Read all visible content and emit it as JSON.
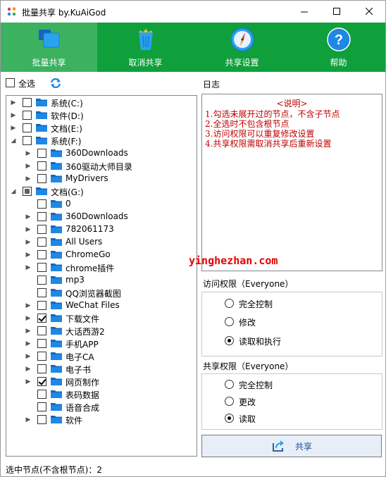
{
  "window": {
    "title": "批量共享 by.KuAiGod",
    "controls": [
      "minimize",
      "maximize",
      "close"
    ]
  },
  "toolbar": {
    "items": [
      {
        "label": "批量共享",
        "icon": "windows-icon",
        "active": true
      },
      {
        "label": "取消共享",
        "icon": "recycle-bin-icon",
        "active": false
      },
      {
        "label": "共享设置",
        "icon": "compass-icon",
        "active": false
      },
      {
        "label": "帮助",
        "icon": "help-icon",
        "active": false
      }
    ]
  },
  "left": {
    "select_all_label": "全选",
    "refresh_icon": "refresh-icon",
    "tree": [
      {
        "label": "系统(C:)",
        "level": 0,
        "arrow": "collapsed",
        "check": "none"
      },
      {
        "label": "软件(D:)",
        "level": 0,
        "arrow": "collapsed",
        "check": "none"
      },
      {
        "label": "文档(E:)",
        "level": 0,
        "arrow": "collapsed",
        "check": "none"
      },
      {
        "label": "系统(F:)",
        "level": 0,
        "arrow": "expanded",
        "check": "none"
      },
      {
        "label": "360Downloads",
        "level": 1,
        "arrow": "collapsed",
        "check": "none"
      },
      {
        "label": "360驱动大师目录",
        "level": 1,
        "arrow": "collapsed",
        "check": "none"
      },
      {
        "label": "MyDrivers",
        "level": 1,
        "arrow": "collapsed",
        "check": "none"
      },
      {
        "label": "文档(G:)",
        "level": 0,
        "arrow": "expanded",
        "check": "partial"
      },
      {
        "label": "0",
        "level": 1,
        "arrow": "none",
        "check": "none"
      },
      {
        "label": "360Downloads",
        "level": 1,
        "arrow": "collapsed",
        "check": "none"
      },
      {
        "label": "782061173",
        "level": 1,
        "arrow": "collapsed",
        "check": "none"
      },
      {
        "label": "All Users",
        "level": 1,
        "arrow": "collapsed",
        "check": "none"
      },
      {
        "label": "ChromeGo",
        "level": 1,
        "arrow": "collapsed",
        "check": "none"
      },
      {
        "label": "chrome插件",
        "level": 1,
        "arrow": "collapsed",
        "check": "none"
      },
      {
        "label": "mp3",
        "level": 1,
        "arrow": "none",
        "check": "none"
      },
      {
        "label": "QQ浏览器截图",
        "level": 1,
        "arrow": "none",
        "check": "none"
      },
      {
        "label": "WeChat Files",
        "level": 1,
        "arrow": "collapsed",
        "check": "none"
      },
      {
        "label": "下载文件",
        "level": 1,
        "arrow": "collapsed",
        "check": "checked"
      },
      {
        "label": "大话西游2",
        "level": 1,
        "arrow": "collapsed",
        "check": "none"
      },
      {
        "label": "手机APP",
        "level": 1,
        "arrow": "collapsed",
        "check": "none"
      },
      {
        "label": "电子CA",
        "level": 1,
        "arrow": "collapsed",
        "check": "none"
      },
      {
        "label": "电子书",
        "level": 1,
        "arrow": "collapsed",
        "check": "none"
      },
      {
        "label": "网页制作",
        "level": 1,
        "arrow": "collapsed",
        "check": "checked"
      },
      {
        "label": "表码数据",
        "level": 1,
        "arrow": "none",
        "check": "none"
      },
      {
        "label": "语音合成",
        "level": 1,
        "arrow": "none",
        "check": "none"
      },
      {
        "label": "软件",
        "level": 1,
        "arrow": "collapsed",
        "check": "none"
      }
    ]
  },
  "log": {
    "label": "日志",
    "header": "<说明>",
    "lines": [
      "1.勾选未展开过的节点，不含子节点",
      "2.全选时不包含根节点",
      "3.访问权限可以重复修改设置",
      "4.共享权限需取消共享后重新设置"
    ],
    "watermark": "yinghezhan.com"
  },
  "access": {
    "label": "访问权限（Everyone）",
    "options": [
      "完全控制",
      "修改",
      "读取和执行"
    ],
    "selected": 2
  },
  "share_perm": {
    "label": "共享权限（Everyone）",
    "options": [
      "完全控制",
      "更改",
      "读取"
    ],
    "selected": 2
  },
  "share_button": {
    "label": "共享",
    "icon": "share-icon"
  },
  "status": {
    "text": "选中节点(不含根节点)：2"
  },
  "colors": {
    "toolbar": "#0fa03c",
    "toolbar_active": "#3cb160",
    "log_text": "#c00000",
    "folder": "#1e88e5"
  }
}
